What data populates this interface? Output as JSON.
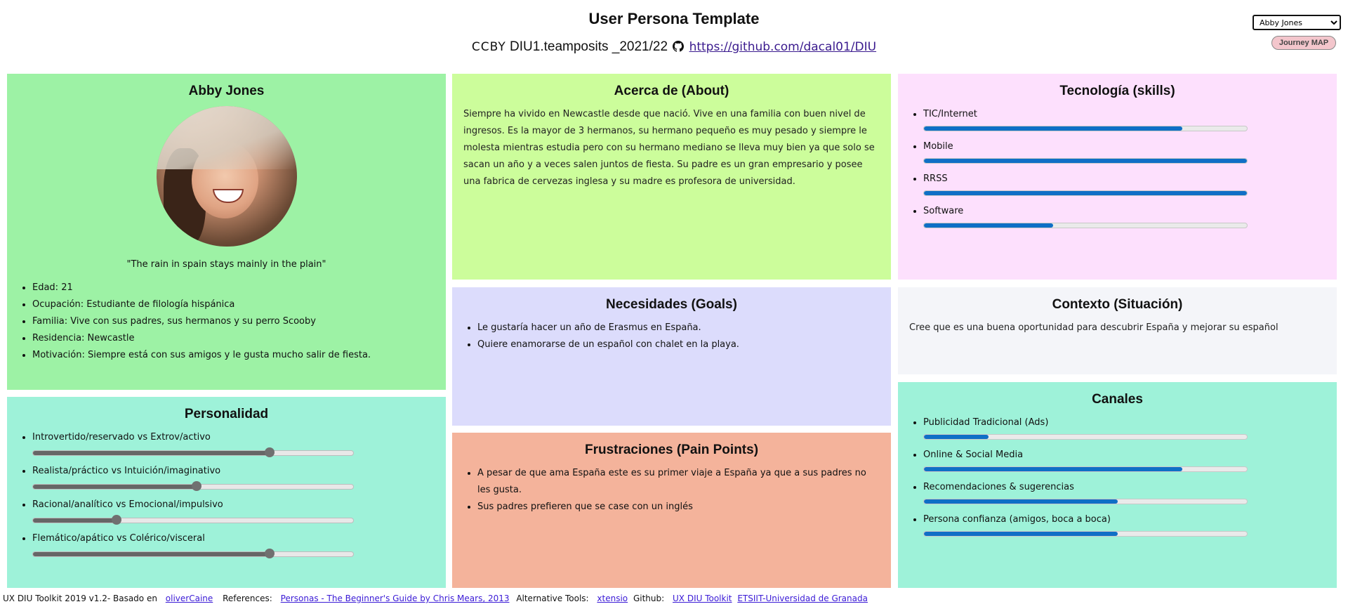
{
  "header": {
    "title": "User Persona Template",
    "license": "CCBY",
    "team": "DIU1.teamposits _2021/22",
    "repo_link": "https://github.com/dacal01/DIU"
  },
  "controls": {
    "persona_selected": "Abby Jones",
    "journey_button": "Journey MAP"
  },
  "profile": {
    "name": "Abby Jones",
    "quote": "\"The rain in spain stays mainly in the plain\"",
    "facts": [
      "Edad: 21",
      "Ocupación: Estudiante de filología hispánica",
      "Familia: Vive con sus padres, sus hermanos y su perro Scooby",
      "Residencia: Newcastle",
      "Motivación: Siempre está con sus amigos y le gusta mucho salir de fiesta."
    ]
  },
  "about": {
    "title": "Acerca de (About)",
    "text": "Siempre ha vivido en Newcastle desde que nació. Vive en una familia con buen nivel de ingresos. Es la mayor de 3 hermanos, su hermano pequeño es muy pesado y siempre le molesta mientras estudia pero con su hermano mediano se lleva muy bien ya que solo se sacan un año y a veces salen juntos de fiesta. Su padre es un gran empresario y posee una fabrica de cervezas inglesa y su madre es profesora de universidad."
  },
  "skills": {
    "title": "Tecnología (skills)",
    "items": [
      {
        "label": "TIC/Internet",
        "value": 0.8
      },
      {
        "label": "Mobile",
        "value": 1.0
      },
      {
        "label": "RRSS",
        "value": 1.0
      },
      {
        "label": "Software",
        "value": 0.4
      }
    ]
  },
  "personality": {
    "title": "Personalidad",
    "items": [
      {
        "label": "Introvertido/reservado vs Extrov/activo",
        "value": 0.74
      },
      {
        "label": "Realista/práctico vs Intuición/imaginativo",
        "value": 0.51
      },
      {
        "label": "Racional/analítico vs Emocional/impulsivo",
        "value": 0.26
      },
      {
        "label": "Flemático/apático vs Colérico/visceral",
        "value": 0.74
      }
    ]
  },
  "goals": {
    "title": "Necesidades (Goals)",
    "items": [
      "Le gustaría hacer un año de Erasmus en España.",
      "Quiere enamorarse de un español con chalet en la playa."
    ]
  },
  "context": {
    "title": "Contexto (Situación)",
    "text": "Cree que es una buena oportunidad para descubrir España y mejorar su español"
  },
  "pain": {
    "title": "Frustraciones (Pain Points)",
    "items": [
      "A pesar de que ama España este es su primer viaje a España ya que a sus padres no les gusta.",
      "Sus padres prefieren que se case con un inglés"
    ]
  },
  "channels": {
    "title": "Canales",
    "items": [
      {
        "label": "Publicidad Tradicional (Ads)",
        "value": 0.2
      },
      {
        "label": "Online & Social Media",
        "value": 0.8
      },
      {
        "label": "Recomendaciones & sugerencias",
        "value": 0.6
      },
      {
        "label": "Persona confianza (amigos, boca a boca)",
        "value": 0.6
      }
    ]
  },
  "footer": {
    "toolkit": "UX DIU Toolkit 2019 v1.2- Basado en",
    "toolkit_link": "oliverCaine",
    "refs_label": "References:",
    "refs_link": "Personas - The Beginner's Guide by Chris Mears, 2013",
    "alt_label": "Alternative Tools:",
    "alt_link": "xtensio",
    "github_label": "Github:",
    "github_link": "UX DIU Toolkit",
    "uni_link": "ETSIIT-Universidad de Granada"
  },
  "colors": {
    "profile_bg": "#9df2a5",
    "about_bg": "#ccfd9b",
    "skills_bg": "#fde0fd",
    "personality_bg": "#9ef2d9",
    "goals_bg": "#dcdcfc",
    "context_bg": "#f4f5f9",
    "pain_bg": "#f4b39b",
    "channels_bg": "#9ef2d9"
  }
}
